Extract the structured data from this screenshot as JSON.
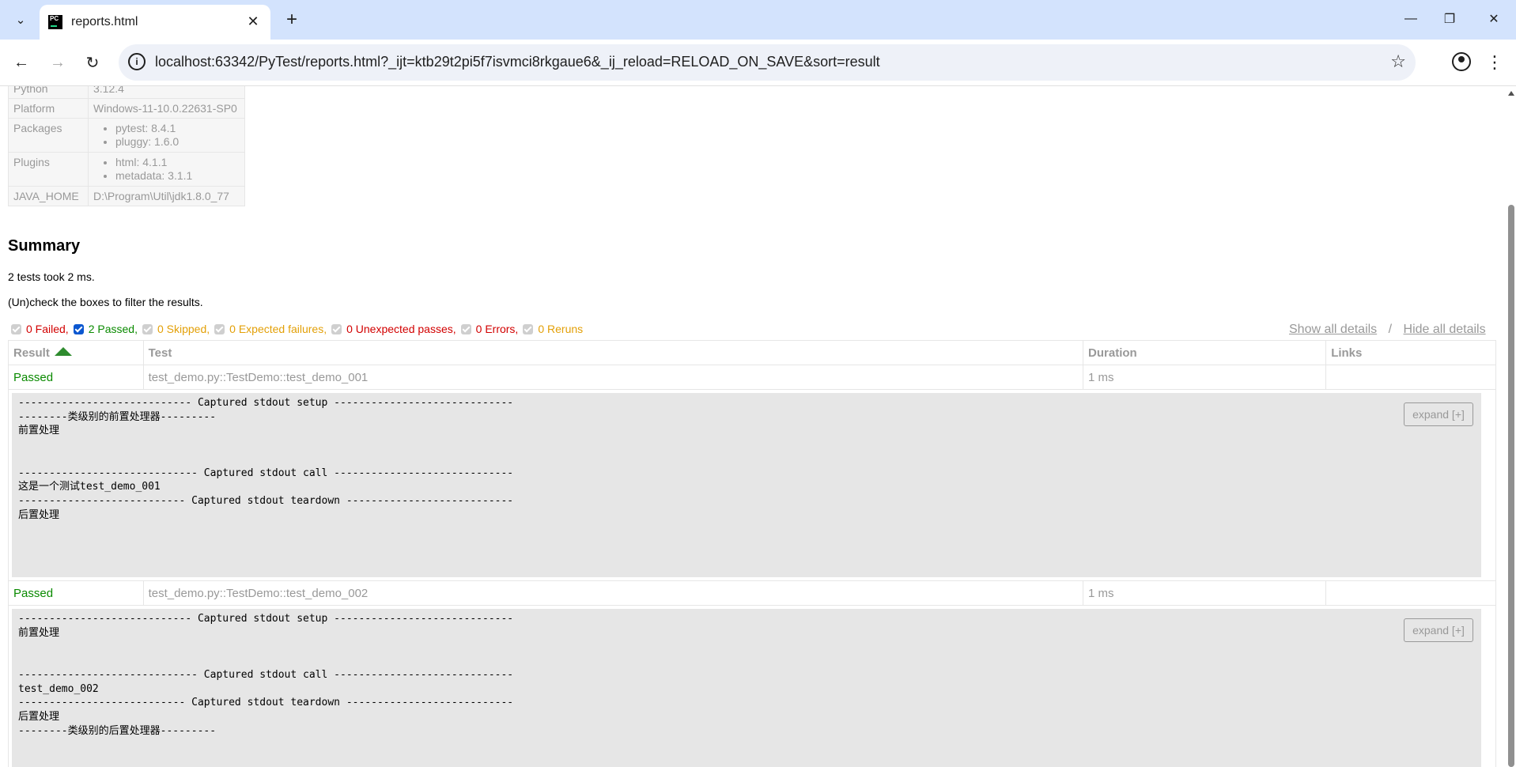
{
  "browser": {
    "tab_title": "reports.html",
    "favicon_text": "PC",
    "url": "localhost:63342/PyTest/reports.html?_ijt=ktb29t2pi5f7isvmci8rkgaue6&_ij_reload=RELOAD_ON_SAVE&sort=result",
    "icons": {
      "tab_search": "chevron-down-icon",
      "tab_close": "close-icon",
      "new_tab": "plus-icon",
      "minimize": "minimize-icon",
      "restore": "restore-icon",
      "close_window": "close-icon",
      "back": "arrow-left-icon",
      "forward": "arrow-right-icon",
      "reload": "reload-icon",
      "site_info": "info-icon",
      "bookmark": "star-icon",
      "profile": "profile-icon",
      "menu": "more-vertical-icon"
    },
    "colors": {
      "tabstrip": "#d3e3fd",
      "omnibox": "#eef1f8"
    }
  },
  "environment": [
    {
      "key": "Python",
      "value": "3.12.4"
    },
    {
      "key": "Platform",
      "value": "Windows-11-10.0.22631-SP0"
    },
    {
      "key": "Packages",
      "items": [
        "pytest: 8.4.1",
        "pluggy: 1.6.0"
      ]
    },
    {
      "key": "Plugins",
      "items": [
        "html: 4.1.1",
        "metadata: 3.1.1"
      ]
    },
    {
      "key": "JAVA_HOME",
      "value": "D:\\Program\\Util\\jdk1.8.0_77"
    }
  ],
  "summary": {
    "title": "Summary",
    "duration_text": "2 tests took 2 ms.",
    "filter_hint": "(Un)check the boxes to filter the results."
  },
  "filters": [
    {
      "label": "0 Failed,",
      "checked": false,
      "color": "#d20000"
    },
    {
      "label": "2 Passed,",
      "checked": true,
      "color": "#0a8a00"
    },
    {
      "label": "0 Skipped,",
      "checked": false,
      "color": "#e3a008"
    },
    {
      "label": "0 Expected failures,",
      "checked": false,
      "color": "#e3a008"
    },
    {
      "label": "0 Unexpected passes,",
      "checked": false,
      "color": "#d20000"
    },
    {
      "label": "0 Errors,",
      "checked": false,
      "color": "#d20000"
    },
    {
      "label": "0 Reruns",
      "checked": false,
      "color": "#e3a008"
    }
  ],
  "details_links": {
    "show_all": "Show all details",
    "separator": "/",
    "hide_all": "Hide all details"
  },
  "table": {
    "headers": {
      "result": "Result",
      "test": "Test",
      "duration": "Duration",
      "links": "Links"
    },
    "rows": [
      {
        "result": "Passed",
        "test": "test_demo.py::TestDemo::test_demo_001",
        "duration": "1 ms",
        "links": "",
        "log": "---------------------------- Captured stdout setup -----------------------------\n--------类级别的前置处理器---------\n前置处理\n\n\n----------------------------- Captured stdout call -----------------------------\n这是一个测试test_demo_001\n--------------------------- Captured stdout teardown ---------------------------\n后置处理",
        "expand_label": "expand [+]"
      },
      {
        "result": "Passed",
        "test": "test_demo.py::TestDemo::test_demo_002",
        "duration": "1 ms",
        "links": "",
        "log": "---------------------------- Captured stdout setup -----------------------------\n前置处理\n\n\n----------------------------- Captured stdout call -----------------------------\ntest_demo_002\n--------------------------- Captured stdout teardown ---------------------------\n后置处理\n--------类级别的后置处理器---------",
        "expand_label": "expand [+]"
      }
    ]
  }
}
